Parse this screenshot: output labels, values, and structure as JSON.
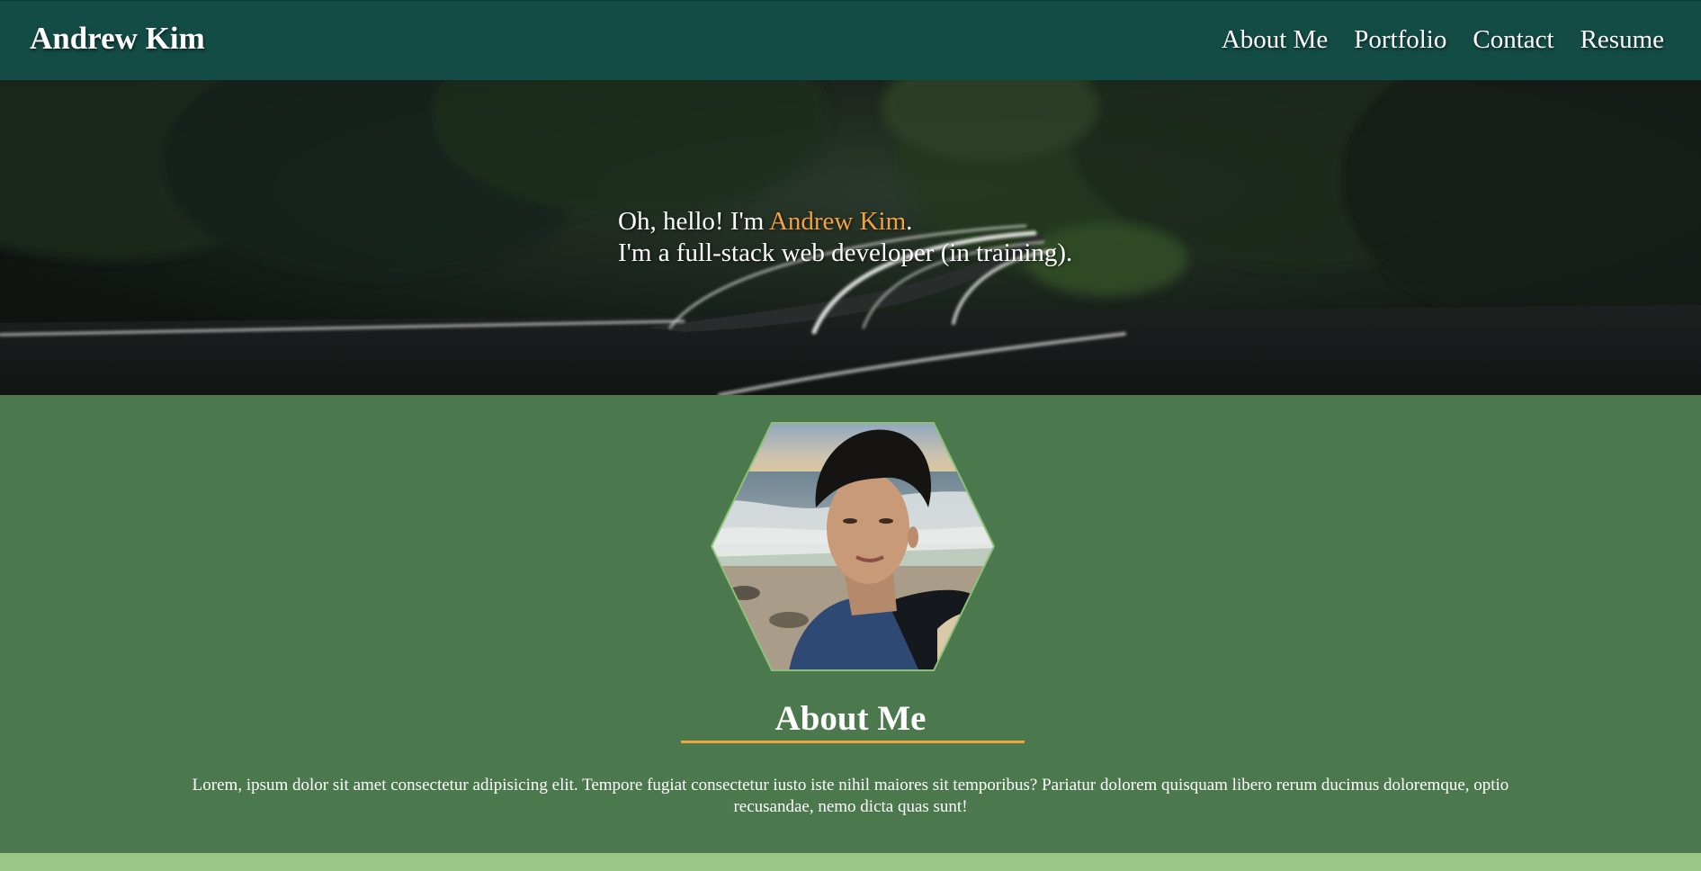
{
  "header": {
    "brand": "Andrew Kim",
    "nav": [
      {
        "label": "About Me"
      },
      {
        "label": "Portfolio"
      },
      {
        "label": "Contact"
      },
      {
        "label": "Resume"
      }
    ]
  },
  "hero": {
    "greeting_prefix": "Oh, hello! I'm ",
    "name": "Andrew Kim",
    "greeting_suffix": ".",
    "tagline": "I'm a full-stack web developer (in training).",
    "image": "forest-road-photo"
  },
  "about": {
    "avatar": "profile-photo-hexagon",
    "heading": "About Me",
    "body": "Lorem, ipsum dolor sit amet consectetur adipisicing elit. Tempore fugiat consectetur iusto iste nihil maiores sit temporibus? Pariatur dolorem quisquam libero rerum ducimus doloremque, optio recusandae, nemo dicta quas sunt!"
  },
  "colors": {
    "header_bg": "#134c45",
    "about_bg": "#4c784e",
    "accent": "#f0a33f",
    "footer_strip": "#9ac786"
  }
}
